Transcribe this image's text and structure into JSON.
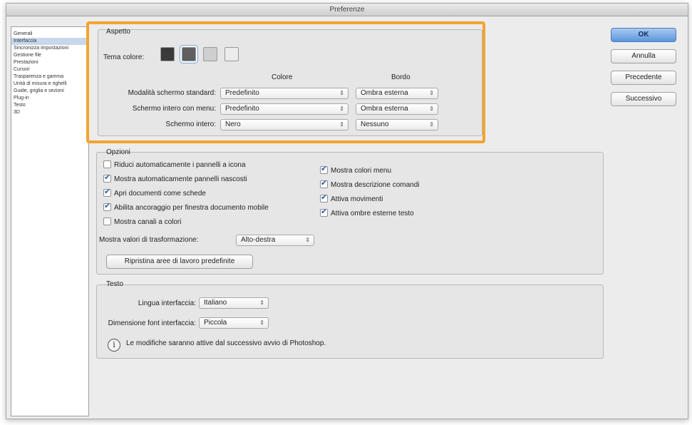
{
  "window": {
    "title": "Preferenze"
  },
  "sidebar": {
    "items": [
      {
        "label": "Generali",
        "selected": false
      },
      {
        "label": "Interfaccia",
        "selected": true
      },
      {
        "label": "Sincronizza impostazioni",
        "selected": false
      },
      {
        "label": "Gestione file",
        "selected": false
      },
      {
        "label": "Prestazioni",
        "selected": false
      },
      {
        "label": "Cursori",
        "selected": false
      },
      {
        "label": "Trasparenza e gamma",
        "selected": false
      },
      {
        "label": "Unità di misura e righelli",
        "selected": false
      },
      {
        "label": "Guide, griglia e sezioni",
        "selected": false
      },
      {
        "label": "Plug-in",
        "selected": false
      },
      {
        "label": "Testo",
        "selected": false
      },
      {
        "label": "3D",
        "selected": false
      }
    ]
  },
  "aspetto": {
    "title": "Aspetto",
    "tema_label": "Tema colore:",
    "swatches": [
      {
        "name": "very-dark",
        "color": "#3a3a3a",
        "selected": false
      },
      {
        "name": "dark",
        "color": "#5f5f5f",
        "selected": true
      },
      {
        "name": "light",
        "color": "#cfcfcf",
        "selected": false
      },
      {
        "name": "very-light",
        "color": "#ececec",
        "selected": false
      }
    ],
    "col_colore": "Colore",
    "col_bordo": "Bordo",
    "rows": [
      {
        "label": "Modalità schermo standard:",
        "colore": "Predefinito",
        "bordo": "Ombra esterna"
      },
      {
        "label": "Schermo intero con menu:",
        "colore": "Predefinito",
        "bordo": "Ombra esterna"
      },
      {
        "label": "Schermo intero:",
        "colore": "Nero",
        "bordo": "Nessuno"
      }
    ]
  },
  "opzioni": {
    "title": "Opzioni",
    "left_checks": [
      {
        "label": "Riduci automaticamente i pannelli a icona",
        "checked": false
      },
      {
        "label": "Mostra automaticamente pannelli nascosti",
        "checked": true
      },
      {
        "label": "Apri documenti come schede",
        "checked": true
      },
      {
        "label": "Abilita ancoraggio per finestra documento mobile",
        "checked": true
      },
      {
        "label": "Mostra canali a colori",
        "checked": false
      }
    ],
    "right_checks": [
      {
        "label": "Mostra colori menu",
        "checked": true
      },
      {
        "label": "Mostra descrizione comandi",
        "checked": true
      },
      {
        "label": "Attiva movimenti",
        "checked": true
      },
      {
        "label": "Attiva ombre esterne testo",
        "checked": true
      }
    ],
    "transform_label": "Mostra valori di trasformazione:",
    "transform_value": "Alto-destra",
    "reset_button": "Ripristina aree di lavoro predefinite"
  },
  "testo": {
    "title": "Testo",
    "lingua_label": "Lingua interfaccia:",
    "lingua_value": "Italiano",
    "dim_label": "Dimensione font interfaccia:",
    "dim_value": "Piccola",
    "info_text": "Le modifiche saranno attive dal successivo avvio di Photoshop."
  },
  "buttons": {
    "ok": "OK",
    "annulla": "Annulla",
    "precedente": "Precedente",
    "successivo": "Successivo"
  },
  "icons": {
    "select_arrows": "⇕",
    "info": "i"
  },
  "colors": {
    "highlight": "#f2a431",
    "default_button": "#5d96dc"
  }
}
